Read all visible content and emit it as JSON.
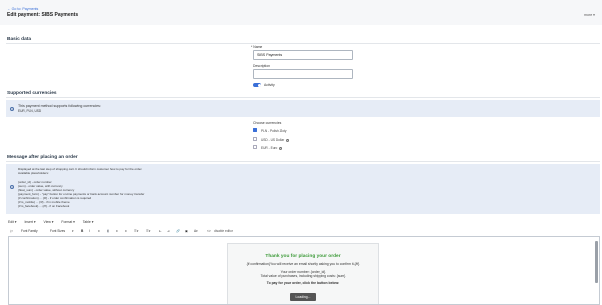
{
  "header": {
    "back_label": "← Go to: Payments",
    "title": "Edit payment: SIBS Payments",
    "more_label": "more ▾"
  },
  "basic": {
    "heading": "Basic data",
    "name_label": "* Name",
    "name_value": "SIBS Payments",
    "description_label": "Description",
    "description_value": "",
    "activity_label": "Activity"
  },
  "currencies": {
    "heading": "Supported currencies",
    "info_title": "This payment method supports following currencies:",
    "info_list": "EUR, PLN, USD",
    "choose_label": "Choose currencies",
    "items": [
      {
        "label": "PLN - Polish Zloty",
        "checked": true,
        "help": false
      },
      {
        "label": "USD - US Dollar",
        "checked": false,
        "help": true
      },
      {
        "label": "EUR - Euro",
        "checked": false,
        "help": true
      }
    ]
  },
  "message": {
    "heading": "Message after placing an order",
    "info_intro": "Displayed at the last step of shopping cart. It should inform customer how to pay for the order.",
    "info_avail": "Available placeholders:",
    "placeholders": [
      "{order_id} - order number",
      "{sum} - order value, with currency",
      "{float_sum} - order value, without currency",
      "{payment_form} - \"pay\" button for on-line payments or bank account number for money transfer",
      "{if confirmation} ... {/if} - if order confirmation is required",
      "{if is_mobile} ... {/if} - if in mobile theme",
      "{if is_facebook} ... {/if} - if on Facebook"
    ]
  },
  "editor": {
    "menus": [
      "Edit ▾",
      "Insert ▾",
      "View ▾",
      "Format ▾",
      "Table ▾"
    ],
    "font_family": "Font Family",
    "font_sizes": "Font Sizes",
    "source_label": "disable editor",
    "email_heading": "Thank you for placing your order",
    "email_confirm": "{if confirmation}You will receive an email shortly asking you to confirm it.{/if}",
    "email_order": "Your order number: {order_id}",
    "email_total": "Total value of purchases, including shipping costs: {sum}",
    "email_pay": "To pay for your order, click the button below:",
    "email_button": "Loading..."
  },
  "colors": {
    "accent": "#3a6fd8",
    "info_bg": "#e6ecf6",
    "success": "#3c9a38"
  }
}
